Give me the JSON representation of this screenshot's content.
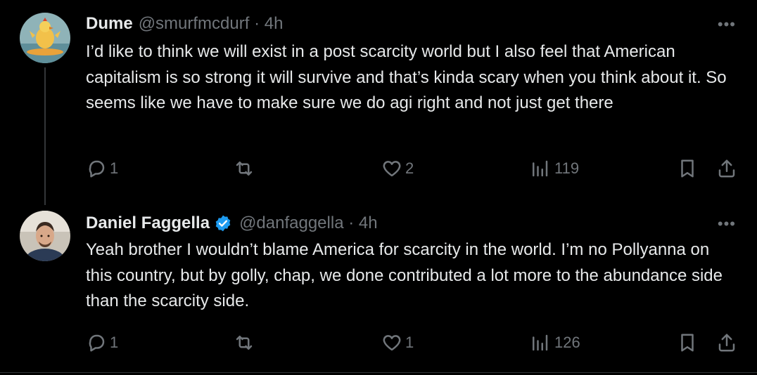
{
  "tweets": [
    {
      "name": "Dume",
      "handle": "@smurfmcdurf · 4h",
      "verified": false,
      "more": "•••",
      "text": "I’d like to think we will exist in a post scarcity world but I also feel that American capitalism is so strong it will survive and that’s kinda scary when you think about it. So seems like we have to make sure we do agi right and not just get there",
      "replies": "1",
      "reposts": "",
      "likes": "2",
      "views": "119"
    },
    {
      "name": "Daniel Faggella",
      "handle": "@danfaggella · 4h",
      "verified": true,
      "more": "•••",
      "text": "Yeah brother I wouldn’t blame America for scarcity in the world. I’m no Pollyanna on this country, but by golly, chap, we done contributed a lot more to the abundance side than the scarcity side.",
      "replies": "1",
      "reposts": "",
      "likes": "1",
      "views": "126"
    }
  ],
  "colors": {
    "background": "#000000",
    "text": "#e7e9ea",
    "secondary": "#71767b",
    "verified": "#1d9bf0"
  }
}
